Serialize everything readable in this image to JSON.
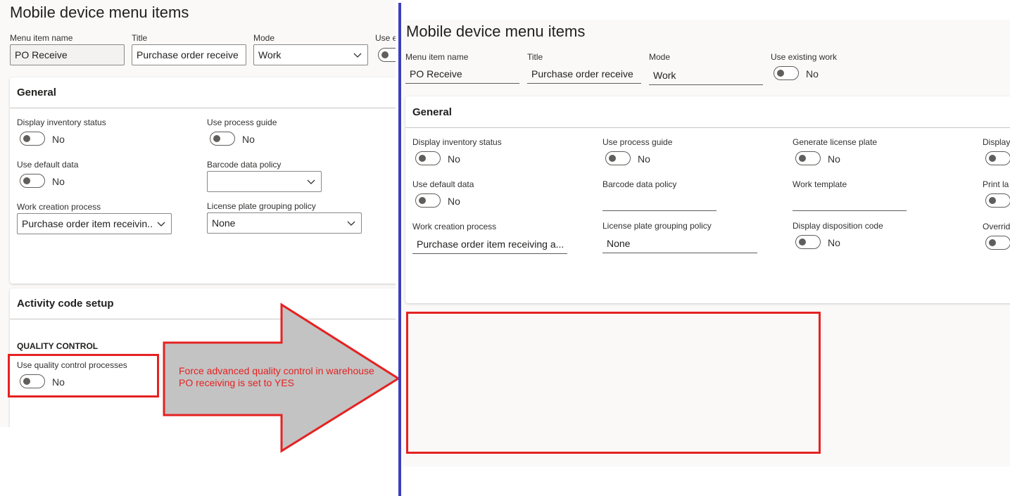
{
  "left": {
    "page_title": "Mobile device menu items",
    "header_fields": {
      "menu_item_name_label": "Menu item name",
      "menu_item_name_value": "PO Receive",
      "title_label": "Title",
      "title_value": "Purchase order receive",
      "mode_label": "Mode",
      "mode_value": "Work",
      "use_existing_work_label_clipped": "Use e"
    },
    "general": {
      "title": "General",
      "display_inventory_status_label": "Display inventory status",
      "display_inventory_status_value": "No",
      "use_process_guide_label": "Use process guide",
      "use_process_guide_value": "No",
      "use_default_data_label": "Use default data",
      "use_default_data_value": "No",
      "barcode_data_policy_label": "Barcode data policy",
      "barcode_data_policy_value": "",
      "work_creation_process_label": "Work creation process",
      "work_creation_process_value": "Purchase order item receivin...",
      "license_plate_grouping_policy_label": "License plate grouping policy",
      "license_plate_grouping_policy_value": "None"
    },
    "activity": {
      "title": "Activity code setup",
      "quality_control_heading": "QUALITY CONTROL",
      "use_qc_processes_label": "Use quality control processes",
      "use_qc_processes_value": "No"
    }
  },
  "annotation": {
    "arrow_text": "Force advanced quality control in warehouse PO receiving is set to YES",
    "arrow_fill": "#c3c3c3",
    "highlight_color": "#e52222"
  },
  "right": {
    "page_title": "Mobile device menu items",
    "header_fields": {
      "menu_item_name_label": "Menu item name",
      "menu_item_name_value": "PO Receive",
      "title_label": "Title",
      "title_value": "Purchase order receive",
      "mode_label": "Mode",
      "mode_value": "Work",
      "use_existing_work_label": "Use existing work",
      "use_existing_work_value": "No"
    },
    "general": {
      "title": "General",
      "display_inventory_status_label": "Display inventory status",
      "display_inventory_status_value": "No",
      "use_process_guide_label": "Use process guide",
      "use_process_guide_value": "No",
      "generate_license_plate_label": "Generate license plate",
      "generate_license_plate_value": "No",
      "display_clipped_label": "Display",
      "use_default_data_label": "Use default data",
      "use_default_data_value": "No",
      "barcode_data_policy_label": "Barcode data policy",
      "barcode_data_policy_value": "",
      "work_template_label": "Work template",
      "work_template_value": "",
      "print_clipped_label": "Print la",
      "work_creation_process_label": "Work creation process",
      "work_creation_process_value": "Purchase order item receiving a...",
      "license_plate_grouping_policy_label": "License plate grouping policy",
      "license_plate_grouping_policy_value": "None",
      "display_disposition_code_label": "Display disposition code",
      "display_disposition_code_value": "No",
      "override_clipped_label": "Overrid"
    }
  }
}
